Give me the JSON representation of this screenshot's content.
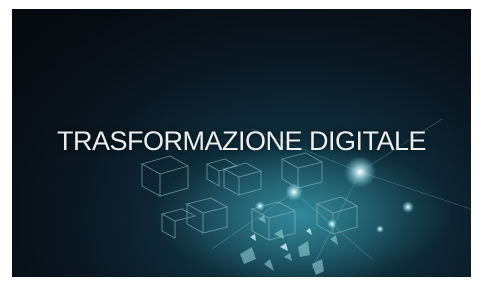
{
  "hero": {
    "headline": "TRASFORMAZIONE DIGITALE"
  },
  "colors": {
    "background_dark": "#05090e",
    "glow_teal": "#1d5a6a",
    "text": "#e9eef1"
  }
}
